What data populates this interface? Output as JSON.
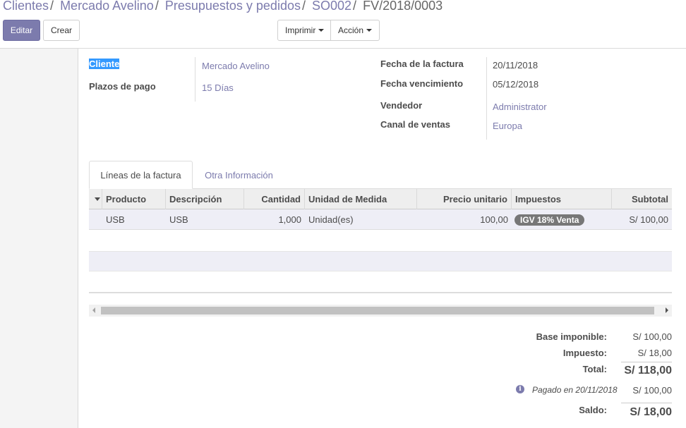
{
  "breadcrumb": {
    "items": [
      "Clientes",
      "Mercado Avelino",
      "Presupuestos y pedidos",
      "SO002"
    ],
    "current": "FV/2018/0003",
    "separator": "/"
  },
  "toolbar": {
    "edit_label": "Editar",
    "create_label": "Crear",
    "print_label": "Imprimir",
    "action_label": "Acción"
  },
  "form": {
    "cliente_label": "Cliente",
    "cliente_value": "Mercado Avelino",
    "plazos_label": "Plazos de pago",
    "plazos_value": "15 Días",
    "fecha_factura_label": "Fecha de la factura",
    "fecha_factura_value": "20/11/2018",
    "fecha_venc_label": "Fecha vencimiento",
    "fecha_venc_value": "05/12/2018",
    "vendedor_label": "Vendedor",
    "vendedor_value": "Administrator",
    "canal_label": "Canal de ventas",
    "canal_value": "Europa"
  },
  "tabs": [
    {
      "label": "Líneas de la factura",
      "active": true
    },
    {
      "label": "Otra Información",
      "active": false
    }
  ],
  "table": {
    "headers": [
      "Producto",
      "Descripción",
      "Cantidad",
      "Unidad de Medida",
      "Precio unitario",
      "Impuestos",
      "Subtotal"
    ],
    "rows": [
      {
        "producto": "USB",
        "descripcion": "USB",
        "cantidad": "1,000",
        "unidad": "Unidad(es)",
        "precio": "100,00",
        "impuestos": "IGV 18% Venta",
        "subtotal": "S/ 100,00"
      }
    ]
  },
  "totals": {
    "base_label": "Base imponible:",
    "base_value": "S/ 100,00",
    "impuesto_label": "Impuesto:",
    "impuesto_value": "S/ 18,00",
    "total_label": "Total:",
    "total_value": "S/ 118,00",
    "pagado_text": "Pagado en 20/11/2018",
    "pagado_value": "S/ 100,00",
    "saldo_label": "Saldo:",
    "saldo_value": "S/ 18,00"
  },
  "colors": {
    "primary": "#7c7bad",
    "selection": "#3399ff",
    "badge": "#777777"
  }
}
